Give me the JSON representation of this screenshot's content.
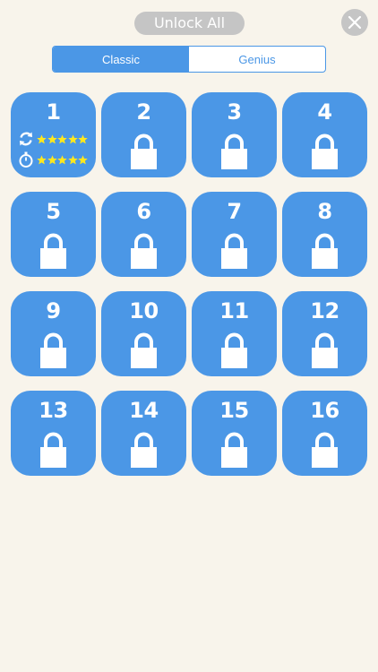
{
  "header": {
    "unlock_all_label": "Unlock All"
  },
  "tabs": [
    {
      "label": "Classic",
      "active": true
    },
    {
      "label": "Genius",
      "active": false
    }
  ],
  "levels": [
    {
      "number": "1",
      "locked": false,
      "moves_stars": 5,
      "time_stars": 5
    },
    {
      "number": "2",
      "locked": true
    },
    {
      "number": "3",
      "locked": true
    },
    {
      "number": "4",
      "locked": true
    },
    {
      "number": "5",
      "locked": true
    },
    {
      "number": "6",
      "locked": true
    },
    {
      "number": "7",
      "locked": true
    },
    {
      "number": "8",
      "locked": true
    },
    {
      "number": "9",
      "locked": true
    },
    {
      "number": "10",
      "locked": true
    },
    {
      "number": "11",
      "locked": true
    },
    {
      "number": "12",
      "locked": true
    },
    {
      "number": "13",
      "locked": true
    },
    {
      "number": "14",
      "locked": true
    },
    {
      "number": "15",
      "locked": true
    },
    {
      "number": "16",
      "locked": true
    }
  ],
  "icons": {
    "close": "close-icon",
    "lock": "lock-icon",
    "moves": "refresh-icon",
    "time": "stopwatch-icon",
    "star": "star-icon"
  },
  "colors": {
    "background": "#f8f4eb",
    "tile": "#4b97e6",
    "pill": "#c5c5c5",
    "star": "#ffe81e"
  }
}
